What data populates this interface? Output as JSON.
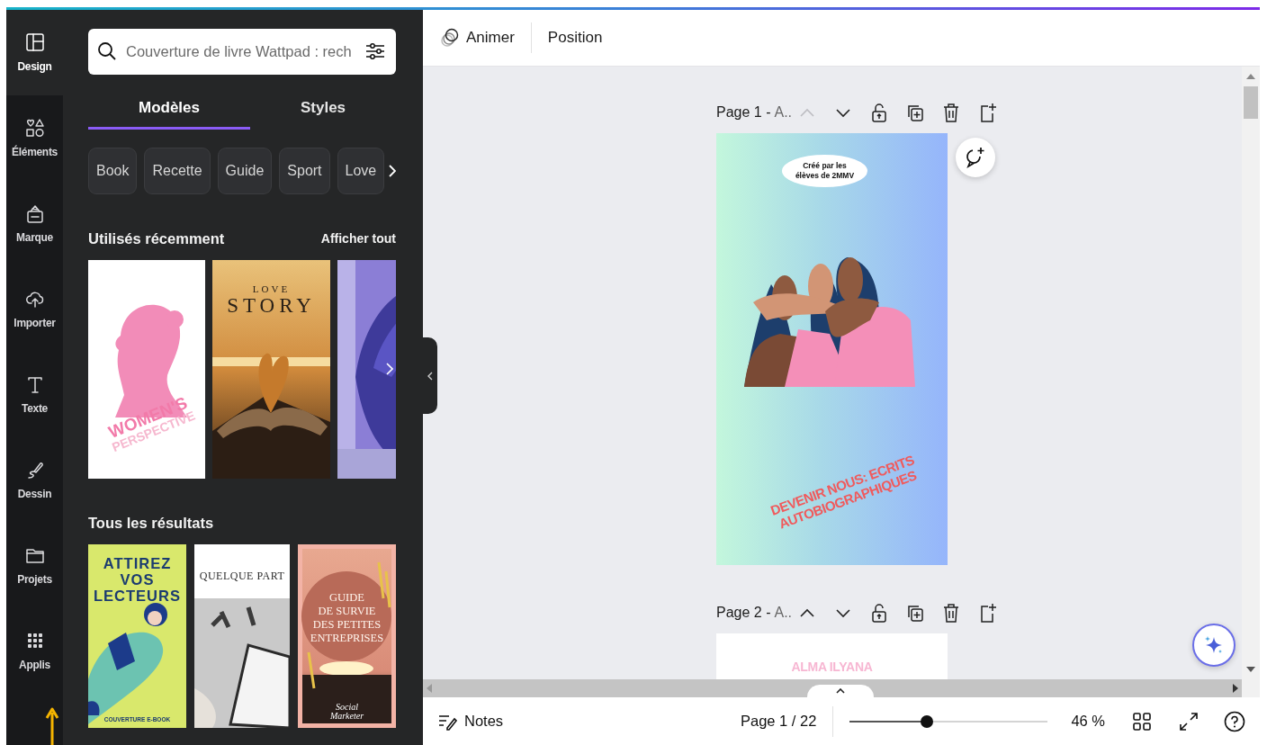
{
  "rail": [
    {
      "label": "Design",
      "selected": true
    },
    {
      "label": "Éléments",
      "selected": false
    },
    {
      "label": "Marque",
      "selected": false
    },
    {
      "label": "Importer",
      "selected": false
    },
    {
      "label": "Texte",
      "selected": false
    },
    {
      "label": "Dessin",
      "selected": false
    },
    {
      "label": "Projets",
      "selected": false
    },
    {
      "label": "Applis",
      "selected": false
    }
  ],
  "panel": {
    "search": {
      "placeholder": "Couverture de livre Wattpad : rech"
    },
    "tabs": [
      {
        "label": "Modèles",
        "selected": true
      },
      {
        "label": "Styles",
        "selected": false
      }
    ],
    "chips": [
      "Book",
      "Recette",
      "Guide",
      "Sport",
      "Love"
    ],
    "recent": {
      "title": "Utilisés récemment",
      "action": "Afficher tout",
      "items": [
        {
          "kind": "picture",
          "lines": [
            "WOMEN'S",
            "PERSPECTIVE"
          ]
        },
        {
          "kind": "picture",
          "lines": [
            "LOVE",
            "STORY"
          ]
        },
        {
          "kind": "picture"
        }
      ]
    },
    "results": {
      "title": "Tous les résultats",
      "items": [
        {
          "kind": "picture",
          "lines": [
            "ATTIREZ",
            "VOS",
            "LECTEURS"
          ],
          "footer": "COUVERTURE E-BOOK"
        },
        {
          "kind": "picture",
          "lines": [
            "QUELQUE PART"
          ]
        },
        {
          "kind": "picture",
          "lines": [
            "GUIDE",
            "DE SURVIE",
            "DES PETITES",
            "ENTREPRISES"
          ],
          "footer": "Social\nMarketer"
        }
      ]
    }
  },
  "toolbar": [
    "Animer",
    "Position"
  ],
  "pages": [
    {
      "label": "Page 1 -",
      "name": "A..",
      "up_disabled": true,
      "kind": "cover",
      "badge": "Créé par les\nélèves de 2MMV",
      "headline": "DEVENIR NOUS: ECRITS\nAUTOBIOGRAPHIQUES"
    },
    {
      "label": "Page 2 -",
      "name": "A..",
      "up_disabled": false,
      "kind": "plain",
      "headline": "ALMA ILYANA"
    }
  ],
  "footer": {
    "notes": "Notes",
    "page_counter": "Page 1 / 22",
    "zoom": {
      "level": 0.39,
      "reading": "46 %"
    }
  }
}
